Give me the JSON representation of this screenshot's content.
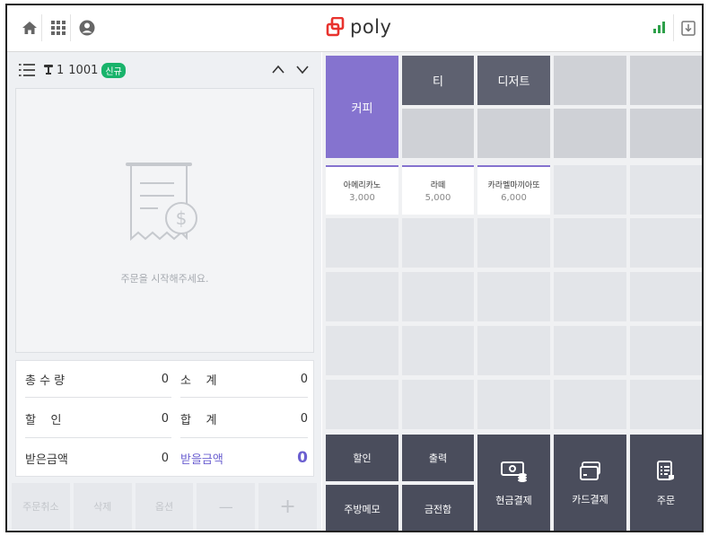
{
  "header": {
    "logo_text": "poly",
    "brand_color": "#e8332e",
    "icons": [
      "home-icon",
      "grid-icon",
      "user-icon",
      "signal-icon",
      "download-icon"
    ]
  },
  "order": {
    "table_no": "1",
    "order_no": "1001",
    "badge": "신규",
    "empty_message": "주문을 시작해주세요."
  },
  "totals": {
    "qty_label": "총 수 량",
    "qty_value": "0",
    "subtotal_label": "소    계",
    "subtotal_value": "0",
    "discount_label": "할    인",
    "discount_value": "0",
    "total_label": "합    계",
    "total_value": "0",
    "received_label": "받은금액",
    "received_value": "0",
    "due_label": "받을금액",
    "due_value": "0",
    "accent": "#6b5fd0"
  },
  "left_buttons": {
    "cancel": "주문취소",
    "delete": "삭제",
    "option": "옵션",
    "minus": "—",
    "plus": "+"
  },
  "categories": {
    "coffee": "커피",
    "tea": "티",
    "dessert": "디저트"
  },
  "items": [
    {
      "name": "아메리카노",
      "price": "3,000"
    },
    {
      "name": "라떼",
      "price": "5,000"
    },
    {
      "name": "카라멜마끼아또",
      "price": "6,000"
    }
  ],
  "functions": {
    "discount": "할인",
    "print": "출력",
    "kitchen_memo": "주방메모",
    "cash_drawer": "금전함",
    "cash_pay": "현금결제",
    "card_pay": "카드결제",
    "order": "주문"
  },
  "colors": {
    "category_active": "#8573cf",
    "category_dark": "#5e6170",
    "function_bg": "#4a4d5c",
    "badge": "#19b36b"
  }
}
